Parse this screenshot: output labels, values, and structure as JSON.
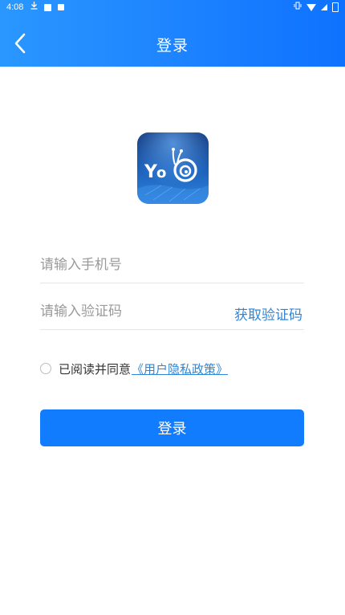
{
  "status_bar": {
    "time": "4:08",
    "icons_left": [
      "download-icon",
      "notification-icon",
      "app-icon"
    ],
    "icons_right": [
      "vibrate-icon",
      "wifi-icon",
      "signal-icon",
      "battery-icon"
    ]
  },
  "header": {
    "title": "登录",
    "back_icon": "chevron-left-icon",
    "gradient": [
      "#2a97ff",
      "#0e72ff"
    ]
  },
  "logo": {
    "icon": "snail-app-logo",
    "text": "YO"
  },
  "form": {
    "phone_placeholder": "请输入手机号",
    "phone_value": "",
    "code_placeholder": "请输入验证码",
    "code_value": "",
    "get_code_label": "获取验证码"
  },
  "agreement": {
    "checked": false,
    "text": "已阅读并同意",
    "link_label": "《用户隐私政策》"
  },
  "login_button": {
    "label": "登录"
  },
  "colors": {
    "primary": "#127cff",
    "link": "#2f86d6",
    "placeholder": "#9a9a9a"
  }
}
